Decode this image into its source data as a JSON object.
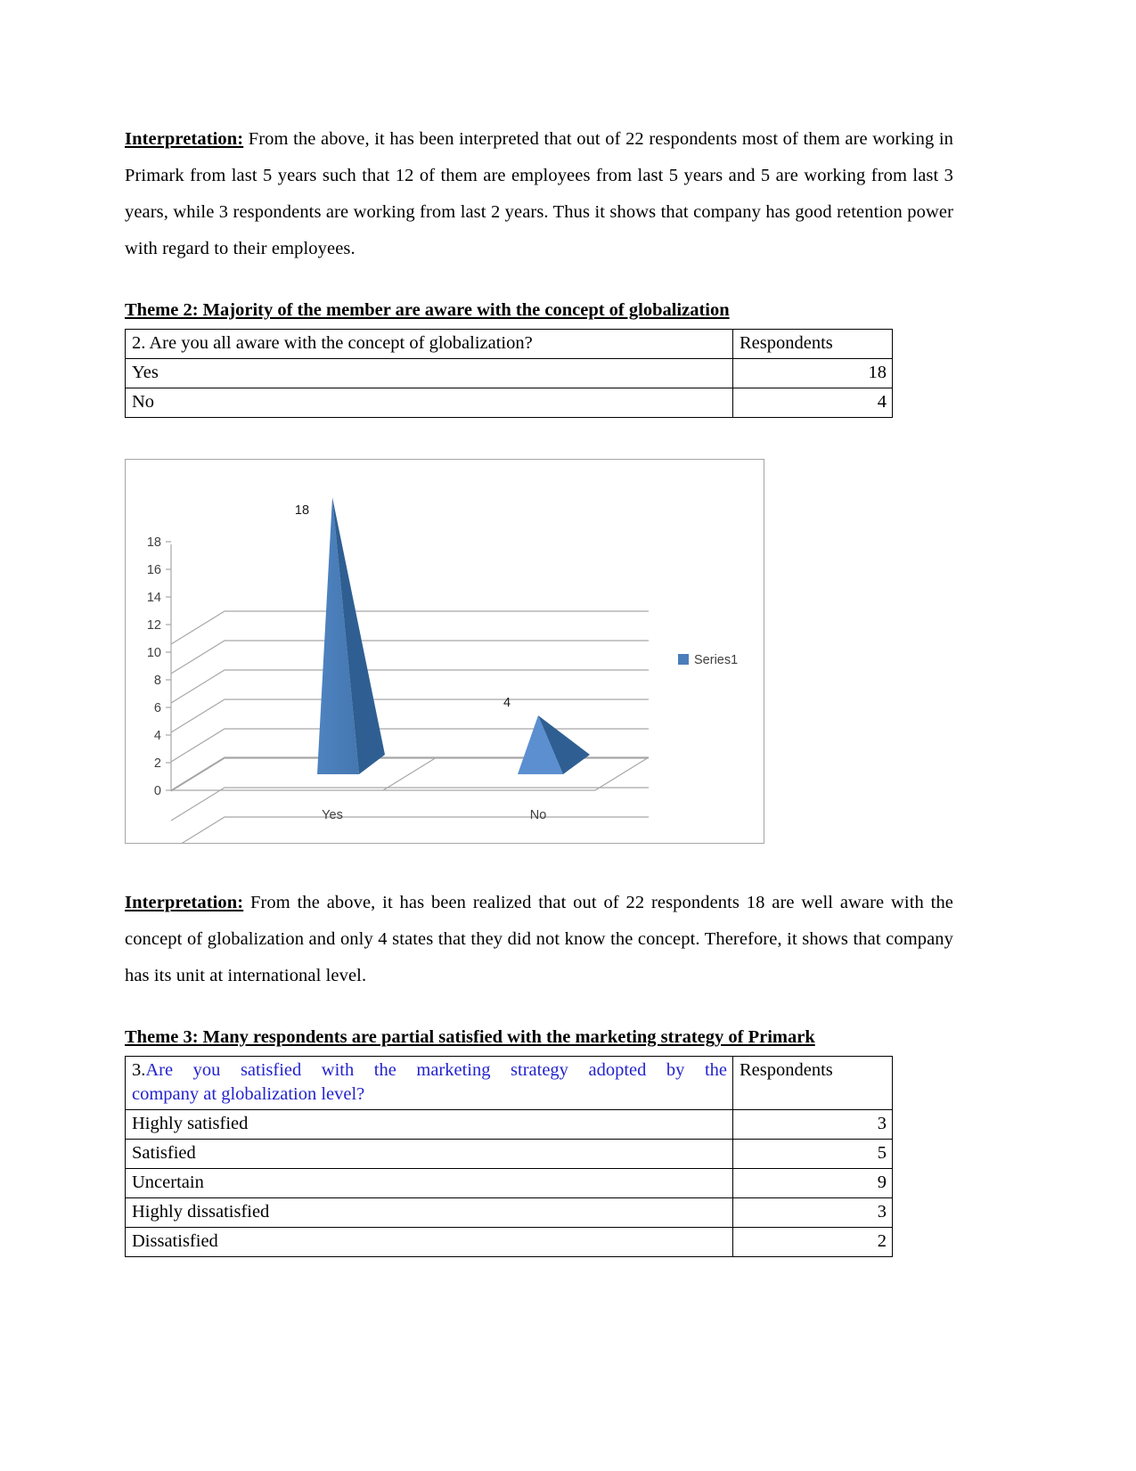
{
  "paragraphs": {
    "interp_label": "Interpretation:",
    "interp1_text": " From the above, it has been interpreted that out of 22 respondents most of them are working in Primark from last 5 years such that 12 of them are employees from last 5 years and 5 are working from last 3 years, while 3 respondents are working from last 2 years. Thus it shows that company has good retention power with regard to their employees.",
    "interp2_text": " From the above, it has been realized that out of 22 respondents 18 are well aware with the concept of globalization and only 4 states that they did not know the concept. Therefore, it shows that company has its unit at international level."
  },
  "theme2": {
    "heading": "Theme 2: Majority of  the member are aware with the  concept of globalization",
    "table": {
      "question": "2. Are you all aware with the concept of globalization?",
      "respondents_header": "Respondents",
      "rows": [
        {
          "label": "Yes",
          "value": "18"
        },
        {
          "label": "No",
          "value": "4"
        }
      ]
    }
  },
  "theme3": {
    "heading": "Theme 3: Many respondents are partial satisfied with the marketing strategy of Primark",
    "table": {
      "question_number": "3.",
      "question": "Are you satisfied with the marketing strategy adopted by the company at globalization level?",
      "question_line1": "Are you satisfied with the marketing strategy adopted by the",
      "question_line2": "company at globalization level?",
      "respondents_header": "Respondents",
      "rows": [
        {
          "label": "Highly satisfied",
          "value": "3"
        },
        {
          "label": "Satisfied",
          "value": "5"
        },
        {
          "label": "Uncertain",
          "value": "9"
        },
        {
          "label": "Highly dissatisfied",
          "value": "3"
        },
        {
          "label": "Dissatisfied",
          "value": "2"
        }
      ]
    }
  },
  "chart_data": {
    "type": "bar",
    "render_style": "3d-pyramid",
    "categories": [
      "Yes",
      "No"
    ],
    "values": [
      18,
      4
    ],
    "data_labels": [
      "18",
      "4"
    ],
    "title": "",
    "xlabel": "",
    "ylabel": "",
    "ylim": [
      0,
      18
    ],
    "yticks": [
      0,
      2,
      4,
      6,
      8,
      10,
      12,
      14,
      16,
      18
    ],
    "ytick_labels": [
      "0",
      "2",
      "4",
      "6",
      "8",
      "10",
      "12",
      "14",
      "16",
      "18"
    ],
    "grid": true,
    "legend": {
      "position": "right",
      "entries": [
        {
          "name": "Series1",
          "color": "#4a7ebb"
        }
      ]
    },
    "colors": {
      "series_front": "#4a7ebb",
      "series_side": "#2f5f92",
      "series_light": "#5b8fd0",
      "gridline": "#a6a6a6",
      "axis_text": "#404040",
      "plot_border": "#a6a6a6"
    }
  }
}
